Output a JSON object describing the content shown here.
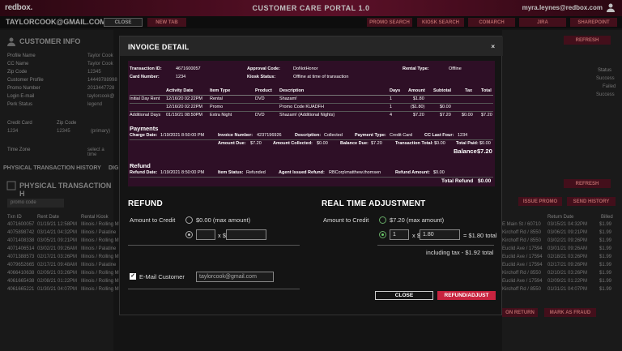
{
  "topbar": {
    "logo": "redbox.",
    "title": "CUSTOMER CARE PORTAL 1.0",
    "user_email": "myra.leynes@redbox.com"
  },
  "subbar": {
    "customer_email": "TAYLORCOOK@GMAIL.COM",
    "close": "CLOSE",
    "new_tab": "NEW TAB",
    "promo_search": "PROMO SEARCH",
    "kiosk_search": "KIOSK SEARCH",
    "comarch": "COMARCH",
    "jira": "JIRA",
    "sharepoint": "SHAREPOINT"
  },
  "left": {
    "customer_info": "CUSTOMER INFO",
    "rows": [
      {
        "label": "Profile Name",
        "value": "Taylor Cook"
      },
      {
        "label": "CC Name",
        "value": "Taylor Cook"
      },
      {
        "label": "Zip Code",
        "value": "12345"
      },
      {
        "label": "Customer Profile",
        "value": "14449788998"
      },
      {
        "label": "Promo Number",
        "value": "2013447728"
      },
      {
        "label": "Login E-mail",
        "value": "taylorcook@"
      },
      {
        "label": "Perk Status",
        "value": "legend"
      }
    ],
    "credit_card": "Credit Card",
    "zip_code": "Zip Code",
    "cc_value": "1234",
    "zip_value": "12345",
    "primary": "(primary)",
    "time_zone": "Time Zone",
    "select_tz": "select a time",
    "phys_hist": "PHYSICAL TRANSACTION HISTORY",
    "dig": "DIG",
    "phys_hist2": "PHYSICAL TRANSACTION H",
    "promo_code": "promo code",
    "cols": [
      "Txn ID",
      "Rent Date",
      "Rental Kiosk"
    ],
    "txn_rows": [
      [
        "4071600057",
        "01/19/21 12:58PM",
        "Illinois / Rolling M"
      ],
      [
        "4075898742",
        "03/14/21 04:32PM",
        "Illinois / Palatine"
      ],
      [
        "4071408338",
        "03/05/21 09:21PM",
        "Illinois / Rolling M"
      ],
      [
        "4071406514",
        "03/02/21 09:26AM",
        "Illinois / Palatine"
      ],
      [
        "4071388573",
        "02/17/21 03:26PM",
        "Illinois / Rolling M"
      ],
      [
        "4079652665",
        "02/17/21 09:48AM",
        "Illinois / Palatine"
      ],
      [
        "4066410638",
        "02/09/21 03:26PM",
        "Illinois / Rolling M"
      ],
      [
        "4061665438",
        "02/08/21 01:22PM",
        "Illinois / Rolling M"
      ],
      [
        "4061665221",
        "01/30/21 04:07PM",
        "Illinois / Rolling M"
      ]
    ]
  },
  "right": {
    "refresh": "REFRESH",
    "status": "Status",
    "statuses": [
      "Success",
      "Failed",
      "Success"
    ],
    "refresh2": "REFRESH",
    "issue_promo": "ISSUE PROMO",
    "send_history": "SEND HISTORY",
    "return_date": "Return Date",
    "billed": "Billed",
    "rows": [
      [
        "E Main St / 60710",
        "03/15/21 04:32PM",
        "$1.99"
      ],
      [
        "Kirchoff Rd / 8550",
        "03/06/21 09:21PM",
        "$1.99"
      ],
      [
        "Kirchoff Rd / 8550",
        "03/02/21 09:26PM",
        "$1.99"
      ],
      [
        "Euclid Ave / 17594",
        "03/01/21 09:26AM",
        "$1.99"
      ],
      [
        "Euclid Ave / 17594",
        "02/18/21 03:26PM",
        "$1.99"
      ],
      [
        "Euclid Ave / 17594",
        "02/17/21 09:26PM",
        "$1.99"
      ],
      [
        "Kirchoff Rd / 8550",
        "02/10/21 03:26PM",
        "$1.99"
      ],
      [
        "Euclid Ave / 17594",
        "02/09/21 01:22PM",
        "$1.99"
      ],
      [
        "Kirchoff Rd / 8550",
        "01/31/21 04:07PM",
        "$1.99"
      ]
    ],
    "btn_return": "ON RETURN",
    "btn_mark": "MARK AS FRAUD"
  },
  "modal": {
    "title": "INVOICE DETAIL",
    "close_x": "×",
    "header": {
      "txn_label": "Transaction ID:",
      "txn_value": "4671600057",
      "card_label": "Card Number:",
      "card_value": "1234",
      "approval_label": "Approval Code:",
      "approval_value": "DoNotHonor",
      "kiosk_label": "Kiosk Status:",
      "kiosk_value": "Offline at time of transaction",
      "rental_label": "Rental Type:",
      "rental_value": "Offline"
    },
    "items": {
      "cols": [
        "",
        "Activity Date",
        "Item Type",
        "Product",
        "Description",
        "Days",
        "Amount",
        "Subtotal",
        "Tax",
        "Total"
      ],
      "rows": [
        [
          "Initial Day Rent",
          "12/16/20 02:22PM",
          "Rental",
          "DVD",
          "Shazam!",
          "1",
          "$1.80",
          "",
          "",
          ""
        ],
        [
          "",
          "12/16/20 02:22PM",
          "Promo",
          "",
          "Promo Code KUADFH",
          "1",
          "($1.80)",
          "$0.00",
          "",
          ""
        ],
        [
          "Additional Days",
          "01/19/21 08:50PM",
          "Extra Night",
          "DVD",
          "Shazam! (Additional Nights)",
          "4",
          "$7.20",
          "$7.20",
          "$0.00",
          "$7.20"
        ]
      ]
    },
    "payments": {
      "title": "Payments",
      "charge_label": "Charge Date:",
      "charge_value": "1/19/2021 8:50:00 PM",
      "invoice_label": "Invoice Number:",
      "invoice_value": "4237196926",
      "desc_label": "Description:",
      "desc_value": "Collected",
      "ptype_label": "Payment Type:",
      "ptype_value": "Credit Card",
      "cc4_label": "CC Last Four:",
      "cc4_value": "1234",
      "due_label": "Amount Due:",
      "due_value": "$7.20",
      "coll_label": "Amount Collected:",
      "coll_value": "$0.00",
      "bal_label": "Balance Due:",
      "bal_value": "$7.20",
      "tt_label": "Transaction Total:",
      "tt_value": "$0.00",
      "tp_label": "Total Paid:",
      "tp_value": "$0.00",
      "balance_label": "Balance",
      "balance_value": "$7.20"
    },
    "refund": {
      "title": "Refund",
      "date_label": "Refund Date:",
      "date_value": "1/19/2021 8:50:00 PM",
      "status_label": "Item Status:",
      "status_value": "Refunded",
      "agent_label": "Agent Issued Refund:",
      "agent_value": "RBCorp\\matthew.thomsen",
      "amt_label": "Refund Amount:",
      "amt_value": "$0.00",
      "total_label": "Total Refund",
      "total_value": "$0.00"
    },
    "refund_sec": {
      "title": "REFUND",
      "amount_label": "Amount to Credit",
      "opt1": "$0.00 (max amount)",
      "x": "x $",
      "qty": "",
      "price": ""
    },
    "rta_sec": {
      "title": "REAL TIME ADJUSTMENT",
      "amount_label": "Amount to Credit",
      "opt1": "$7.20 (max amount)",
      "qty": "1",
      "x": "x $",
      "price": "1.80",
      "total": "= $1.80 total",
      "tax": "including tax - $1.92 total"
    },
    "email": {
      "label": "E-Mail Customer",
      "value": "taylorcook@gmail.com"
    },
    "btn_close": "CLOSE",
    "btn_refund": "REFUND/ADJUST"
  }
}
